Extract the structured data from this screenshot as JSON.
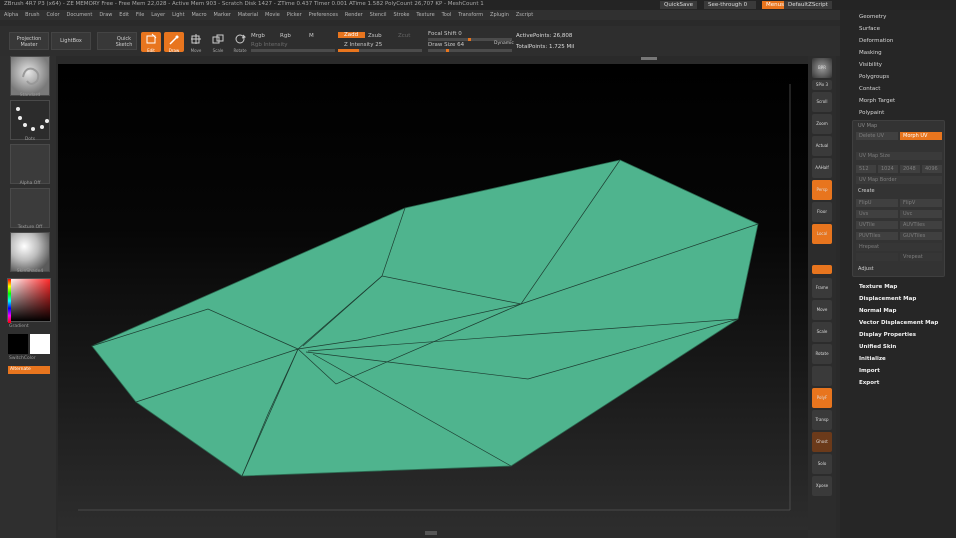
{
  "window": {
    "title": "ZBrush 4R7 P3 (x64) - ZE MEMORY Free - Free Mem 22,028 - Active Mem 903 - Scratch Disk 1427 - ZTime 0.437 Timer 0.001 ATime 1.582 PolyCount 26,707 KP - MeshCount 1",
    "quicksave": "QuickSave",
    "seethrough": "See-through  0",
    "menus": "Menus",
    "defaultzscript": "DefaultZScript"
  },
  "menubar": [
    "Alpha",
    "Brush",
    "Color",
    "Document",
    "Draw",
    "Edit",
    "File",
    "Layer",
    "Light",
    "Macro",
    "Marker",
    "Material",
    "Movie",
    "Picker",
    "Preferences",
    "Render",
    "Stencil",
    "Stroke",
    "Texture",
    "Tool",
    "Transform",
    "Zplugin",
    "Zscript"
  ],
  "toolbar": {
    "projection": "Projection Master",
    "lightbox": "LightBox",
    "quicksketch": "Quick Sketch",
    "edit": "Edit",
    "draw": "Draw",
    "move": "Move",
    "scale": "Scale",
    "rotate": "Rotate",
    "mrgb": "Mrgb",
    "rgb": "Rgb",
    "m": "M",
    "rgb_intensity": "Rgb Intensity",
    "zadd": "Zadd",
    "zsub": "Zsub",
    "zcut": "Zcut",
    "z_intensity": "Z Intensity 25",
    "focal_shift": "Focal Shift 0",
    "draw_size": "Draw Size 64",
    "dynamic": "Dynamic",
    "active_points": "ActivePoints: 26,808",
    "total_points": "TotalPoints: 1.725 Mil"
  },
  "leftshelf": {
    "brush": "Standard",
    "stroke": "Dots",
    "alpha": "Alpha Off",
    "texture": "Texture Off",
    "material": "SkinShade4",
    "gradient": "Gradient",
    "switchcolor": "SwitchColor",
    "alternate": "Alternate"
  },
  "rightshelf": [
    "BPR",
    "SPix 3",
    "Scroll",
    "Zoom",
    "Actual",
    "AAHalf",
    "Persp",
    "Floor",
    "Local",
    "Frame",
    "Move",
    "Scale",
    "Rotate",
    "PolyF",
    "Transp",
    "Ghost",
    "Solo",
    "Xpose"
  ],
  "tray": {
    "top_items": [
      "Geometry",
      "Surface",
      "Deformation",
      "Masking",
      "Visibility",
      "Polygroups",
      "Contact",
      "Morph Target",
      "Polypaint"
    ],
    "uv_map_header": "UV Map",
    "uv_panel": {
      "delete_uv": "Delete UV",
      "morph_uv": "Morph UV",
      "uv_map_size": "UV Map Size",
      "sizes": [
        "512",
        "1024",
        "2048",
        "4096"
      ],
      "uv_map_border": "UV Map Border",
      "create": "Create",
      "flip_u": "FlipU",
      "flip_v": "FlipV",
      "uvs": "Uvs",
      "uvc": "Uvc",
      "uv_tile": "UVTile",
      "auv_tiles": "AUVTiles",
      "puv_tiles": "PUVTiles",
      "guv_tiles": "GUVTiles",
      "hrepeat": "Hrepeat",
      "vrepeat": "Vrepeat",
      "adjust": "Adjust"
    },
    "bottom_items": [
      "Texture Map",
      "Displacement Map",
      "Normal Map",
      "Vector Displacement Map",
      "Display Properties",
      "Unified Skin",
      "Initialize",
      "Import",
      "Export"
    ]
  },
  "colors": {
    "accent": "#e8751e",
    "mesh": "#4fb48e",
    "background": "#2a2a2a"
  }
}
